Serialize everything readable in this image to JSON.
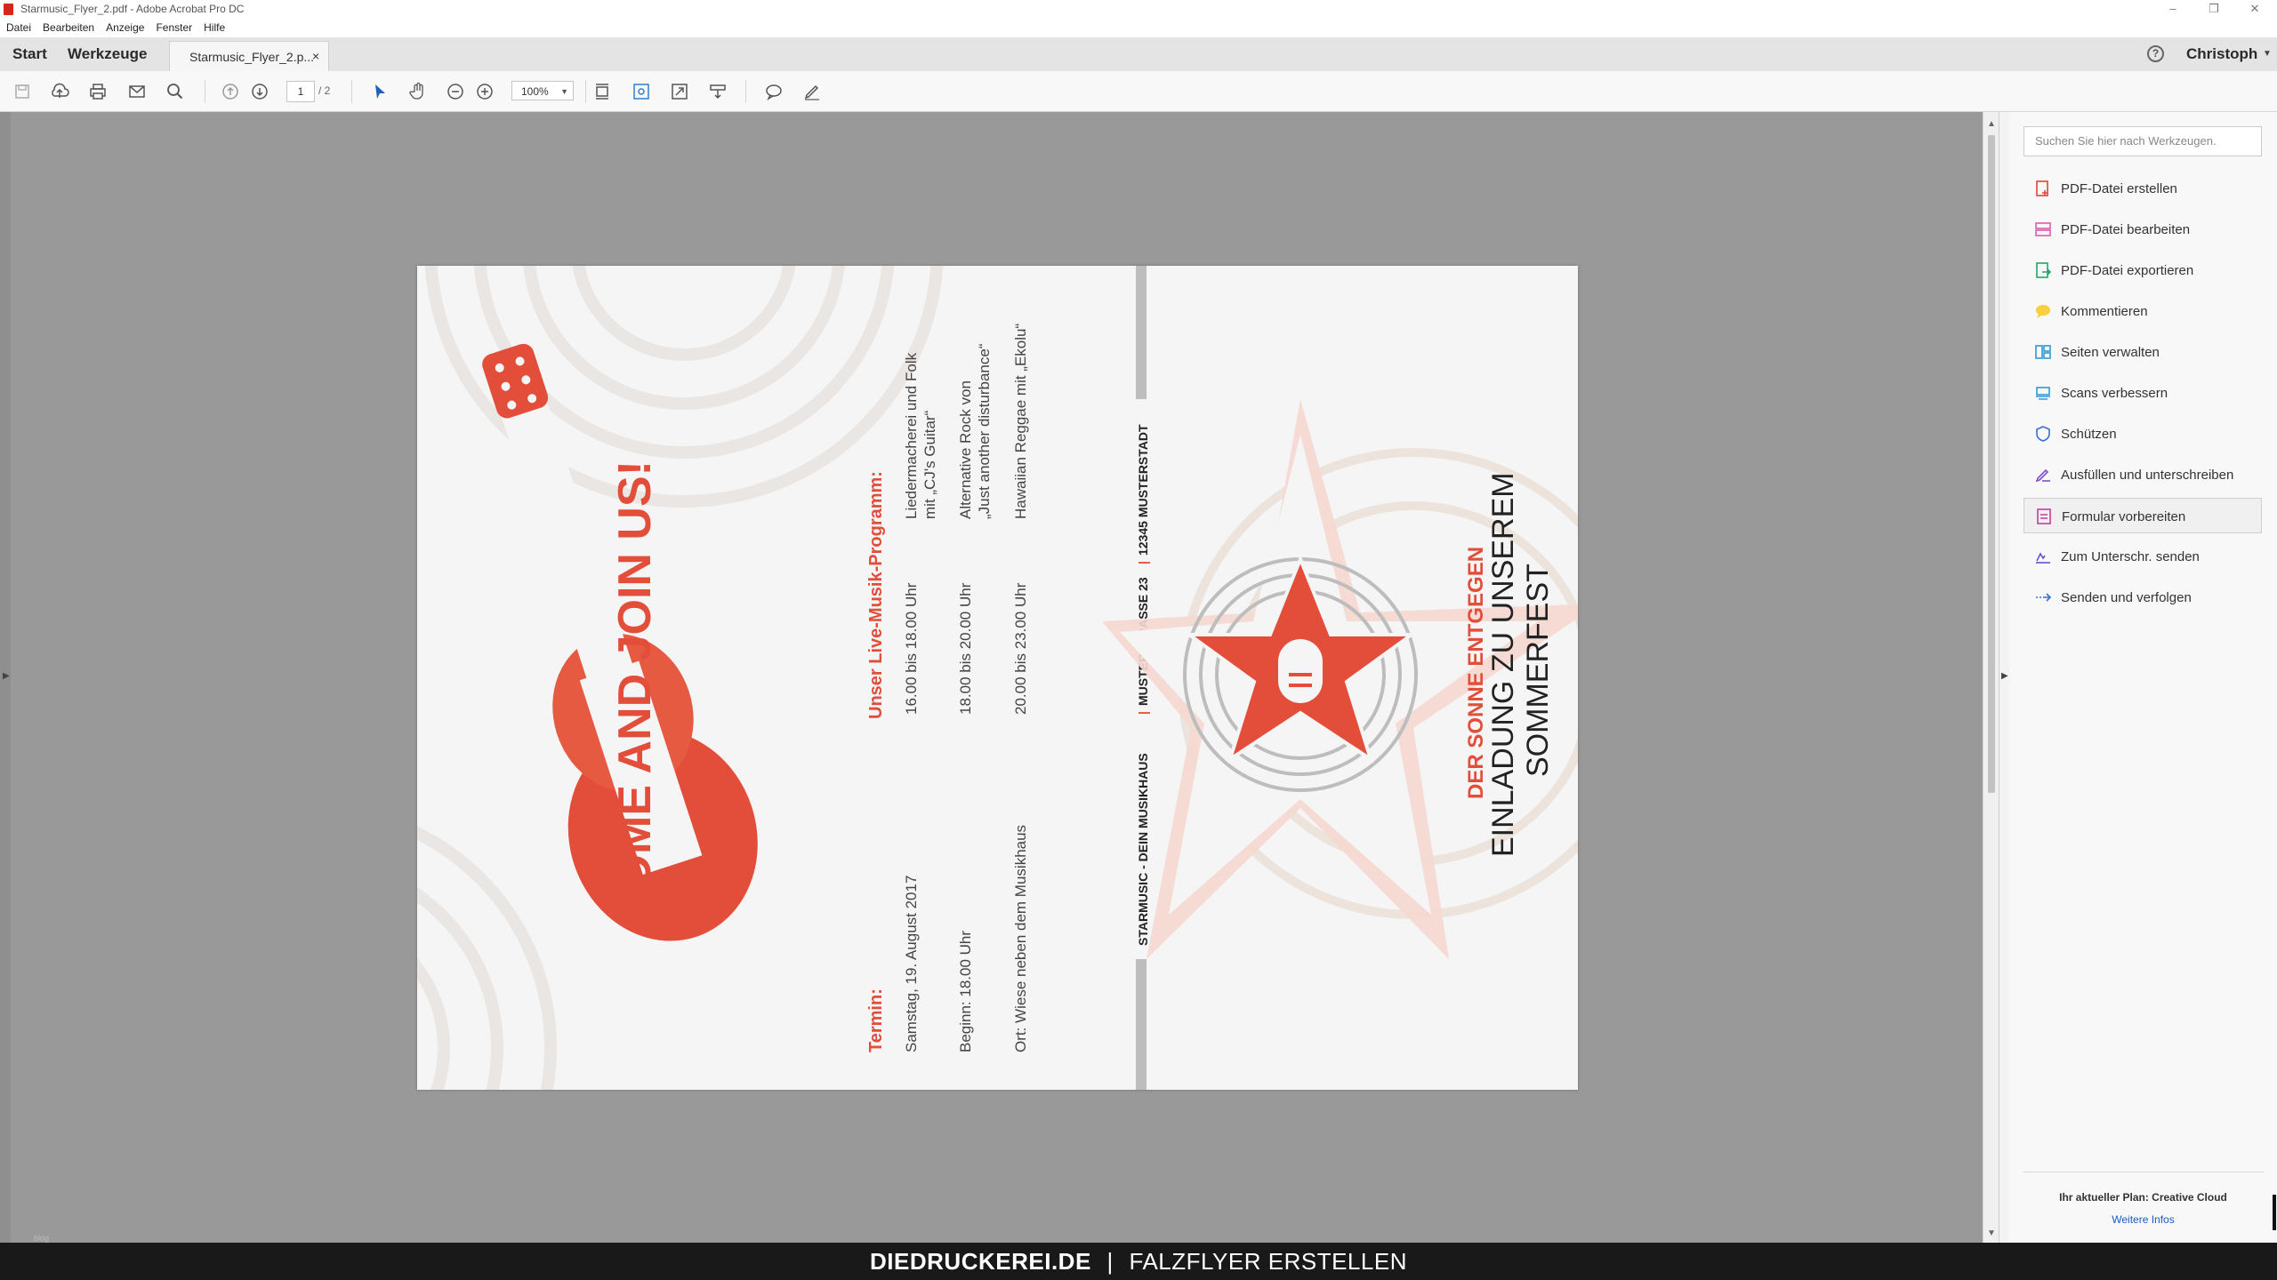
{
  "window": {
    "title": "Starmusic_Flyer_2.pdf - Adobe Acrobat Pro DC",
    "controls": [
      "–",
      "❐",
      "✕"
    ]
  },
  "menu": [
    "Datei",
    "Bearbeiten",
    "Anzeige",
    "Fenster",
    "Hilfe"
  ],
  "tabs": {
    "start": "Start",
    "tools": "Werkzeuge",
    "document": "Starmusic_Flyer_2.p...",
    "close": "×"
  },
  "user": {
    "name": "Christoph",
    "help": "?"
  },
  "toolbar": {
    "page_current": "1",
    "page_total": "/ 2",
    "zoom": "100%",
    "icons": [
      "save-icon",
      "upload-icon",
      "print-icon",
      "email-icon",
      "search-icon",
      "page-up-icon",
      "page-down-icon",
      "select-cursor-icon",
      "hand-icon",
      "zoom-out-icon",
      "zoom-in-icon",
      "fit-page-icon",
      "marquee-zoom-icon",
      "fullscreen-icon",
      "scroll-mode-icon",
      "comment-icon",
      "sign-icon"
    ]
  },
  "flyer": {
    "guitar_text": "COME AND JOIN US!",
    "program_heading": "Unser Live-Musik-Programm:",
    "program": [
      {
        "time": "16.00 bis 18.00 Uhr",
        "line1": "Liedermacherei und Folk",
        "line2": "mit „CJ's Guitar“"
      },
      {
        "time": "18.00 bis 20.00 Uhr",
        "line1": "Alternative Rock von",
        "line2": "„Just another disturbance“"
      },
      {
        "time": "20.00 bis 23.00 Uhr",
        "line1": "Hawaiian Reggae mit „Ekolu“",
        "line2": ""
      }
    ],
    "termin_heading": "Termin:",
    "termin": [
      "Samstag, 19. August 2017",
      "Beginn: 18.00 Uhr",
      "Ort: Wiese neben dem Musikhaus"
    ],
    "address_parts": [
      "STARMUSIC - DEIN MUSIKHAUS",
      "MUSTERSTRASSE 23",
      "12345 MUSTERSTADT"
    ],
    "address_sep": "|",
    "cover_line1": "DER SONNE ENTGEGEN",
    "cover_line2": "EINLADUNG ZU UNSEREM",
    "cover_line3": "SOMMERFEST"
  },
  "tools_pane": {
    "search_placeholder": "Suchen Sie hier nach Werkzeugen.",
    "items": [
      {
        "label": "PDF-Datei erstellen",
        "icon": "create-pdf-icon",
        "color": "#e0443a"
      },
      {
        "label": "PDF-Datei bearbeiten",
        "icon": "edit-pdf-icon",
        "color": "#e05bb0"
      },
      {
        "label": "PDF-Datei exportieren",
        "icon": "export-pdf-icon",
        "color": "#2aa36b"
      },
      {
        "label": "Kommentieren",
        "icon": "comment-tool-icon",
        "color": "#f0c020"
      },
      {
        "label": "Seiten verwalten",
        "icon": "organize-pages-icon",
        "color": "#2f9bd6"
      },
      {
        "label": "Scans verbessern",
        "icon": "enhance-scans-icon",
        "color": "#2f9bd6"
      },
      {
        "label": "Schützen",
        "icon": "protect-icon",
        "color": "#3a6fd0"
      },
      {
        "label": "Ausfüllen und unterschreiben",
        "icon": "fill-sign-icon",
        "color": "#7a4fd0"
      },
      {
        "label": "Formular vorbereiten",
        "icon": "prepare-form-icon",
        "color": "#c43f9a"
      },
      {
        "label": "Zum Unterschr. senden",
        "icon": "send-signature-icon",
        "color": "#6b4fd0"
      },
      {
        "label": "Senden und verfolgen",
        "icon": "send-track-icon",
        "color": "#3a6fd0"
      }
    ],
    "active_index": 8,
    "plan_text": "Ihr aktueller Plan: Creative Cloud",
    "plan_link": "Weitere Infos"
  },
  "status_tiny": "blog",
  "banner": {
    "brand": "DIEDRUCKEREI.DE",
    "sep": "|",
    "tagline": "FALZFLYER ERSTELLEN"
  }
}
